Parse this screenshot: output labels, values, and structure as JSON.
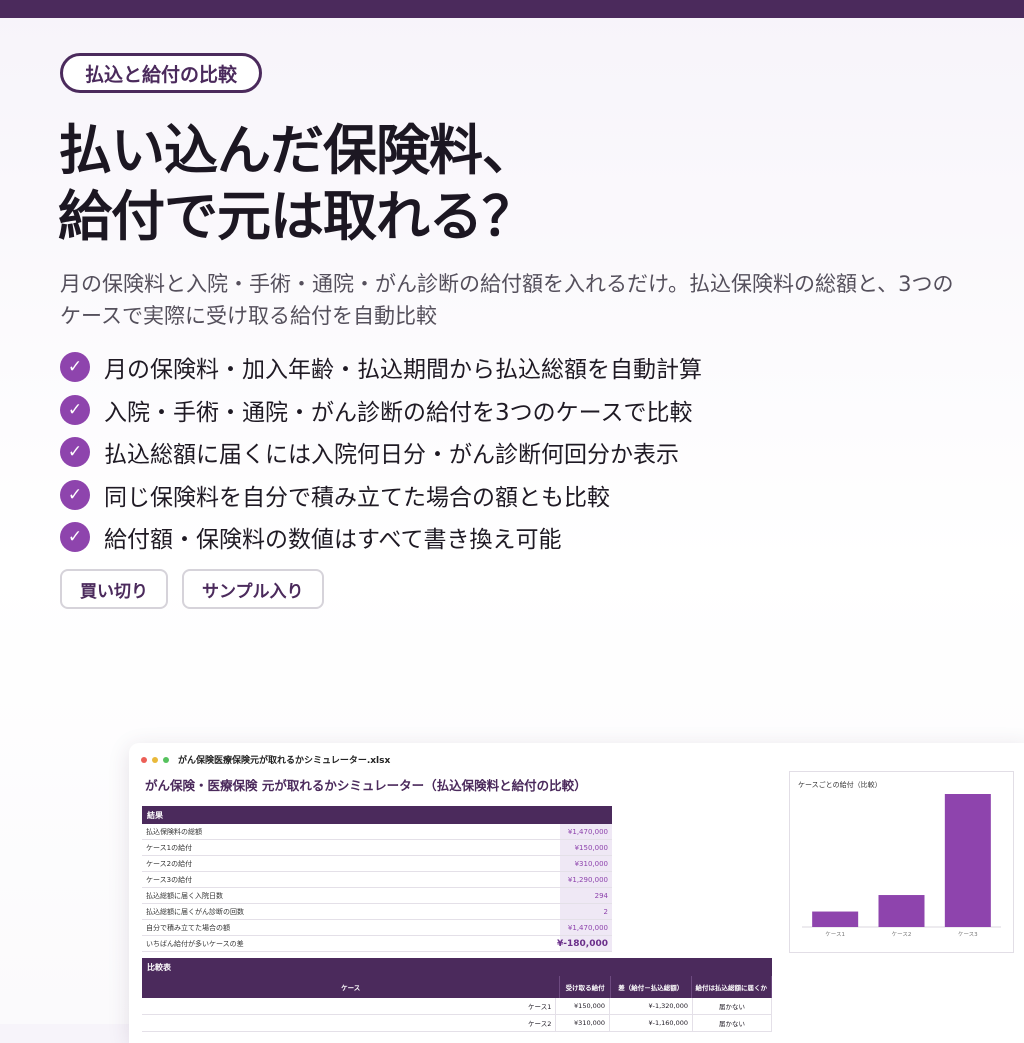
{
  "badge": "払込と給付の比較",
  "headline": [
    "払い込んだ保険料、",
    "給付で元は取れる？"
  ],
  "lead": "月の保険料と入院・手術・通院・がん診断の給付額を入れるだけ。払込保険料の総額と、3つのケースで実際に受け取る給付を自動比較",
  "features": [
    "月の保険料・加入年齢・払込期間から払込総額を自動計算",
    "入院・手術・通院・がん診断の給付を3つのケースで比較",
    "払込総額に届くには入院何日分・がん診断何回分か表示",
    "同じ保険料を自分で積み立てた場合の額とも比較",
    "給付額・保険料の数値はすべて書き換え可能"
  ],
  "check_glyph": "✓",
  "tags": [
    "買い切り",
    "サンプル入り"
  ],
  "colors": {
    "brand": "#4b2a5c",
    "accent": "#8e44ad",
    "cell": "#efe8f5"
  },
  "sheet": {
    "filename": "がん保険医療保険元が取れるかシミュレーター.xlsx",
    "title": "がん保険・医療保険 元が取れるかシミュレーター（払込保険料と給付の比較）",
    "results": {
      "header": "結果",
      "rows": [
        {
          "label": "払込保険料の総額",
          "value": "¥1,470,000"
        },
        {
          "label": "ケース1の給付",
          "value": "¥150,000"
        },
        {
          "label": "ケース2の給付",
          "value": "¥310,000"
        },
        {
          "label": "ケース3の給付",
          "value": "¥1,290,000"
        },
        {
          "label": "払込総額に届く入院日数",
          "value": "294"
        },
        {
          "label": "払込総額に届くがん診断の回数",
          "value": "2"
        },
        {
          "label": "自分で積み立てた場合の額",
          "value": "¥1,470,000"
        },
        {
          "label": "いちばん給付が多いケースの差",
          "value": "¥-180,000"
        }
      ]
    },
    "compare": {
      "header": "比較表",
      "columns": [
        "ケース",
        "受け取る給付",
        "差（給付－払込総額）",
        "給付は払込総額に届くか"
      ],
      "rows": [
        [
          "ケース1",
          "¥150,000",
          "¥-1,320,000",
          "届かない"
        ],
        [
          "ケース2",
          "¥310,000",
          "¥-1,160,000",
          "届かない"
        ]
      ]
    }
  },
  "chart_data": {
    "type": "bar",
    "title": "ケースごとの給付（比較）",
    "categories": [
      "ケース1",
      "ケース2",
      "ケース3"
    ],
    "values": [
      150000,
      310000,
      1290000
    ],
    "ylim": [
      0,
      1290000
    ],
    "grid": false,
    "color": "#8e44ad"
  }
}
